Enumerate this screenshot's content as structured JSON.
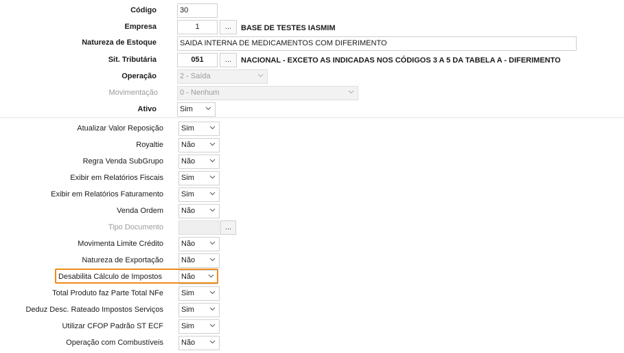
{
  "header": {
    "codigo": {
      "label": "Código",
      "value": "30"
    },
    "empresa": {
      "label": "Empresa",
      "value": "1",
      "button": "...",
      "description": "BASE DE TESTES IASMIM"
    },
    "natureza_estoque": {
      "label": "Natureza de Estoque",
      "value": "SAIDA INTERNA DE MEDICAMENTOS COM DIFERIMENTO"
    },
    "sit_tributaria": {
      "label": "Sit. Tributária",
      "value": "051",
      "button": "...",
      "description": "NACIONAL - EXCETO AS INDICADAS NOS CÓDIGOS 3 A 5 DA TABELA A - DIFERIMENTO"
    },
    "operacao": {
      "label": "Operação",
      "value": "2 - Saída"
    },
    "movimentacao": {
      "label": "Movimentação",
      "value": "0 - Nenhum"
    },
    "ativo": {
      "label": "Ativo",
      "value": "Sim"
    }
  },
  "options": [
    {
      "label": "Atualizar Valor Reposição",
      "value": "Sim"
    },
    {
      "label": "Royaltie",
      "value": "Não"
    },
    {
      "label": "Regra Venda SubGrupo",
      "value": "Não"
    },
    {
      "label": "Exibir em Relatórios Fiscais",
      "value": "Sim"
    },
    {
      "label": "Exibir em Relatórios Faturamento",
      "value": "Sim"
    },
    {
      "label": "Venda Ordem",
      "value": "Não"
    },
    {
      "label": "Tipo Documento",
      "value": "",
      "button": "..."
    },
    {
      "label": "Movimenta Limite Crédito",
      "value": "Não"
    },
    {
      "label": "Natureza de Exportação",
      "value": "Não"
    },
    {
      "label": "Desabilita Cálculo de Impostos",
      "value": "Não"
    },
    {
      "label": "Total Produto faz Parte Total NFe",
      "value": "Sim"
    },
    {
      "label": "Deduz Desc. Rateado Impostos Serviços",
      "value": "Sim"
    },
    {
      "label": "Utilizar CFOP Padrão ST ECF",
      "value": "Sim"
    },
    {
      "label": "Operação com Combustíveis",
      "value": "Não"
    }
  ],
  "colors": {
    "highlight": "#f08a1c",
    "disabled_text": "#9a9a9a"
  }
}
